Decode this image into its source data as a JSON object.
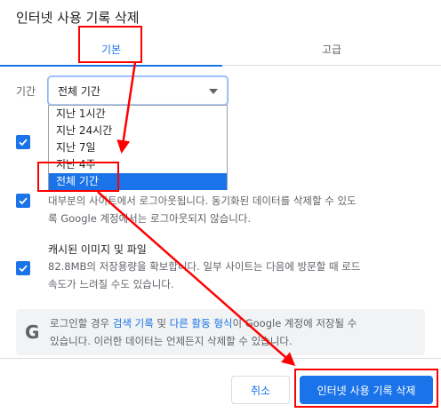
{
  "dialog": {
    "title": "인터넷 사용 기록 삭제"
  },
  "tabs": [
    {
      "label": "기본",
      "active": true
    },
    {
      "label": "고급",
      "active": false
    }
  ],
  "period": {
    "label": "기간",
    "selected": "전체 기간",
    "options": [
      "지난 1시간",
      "지난 24시간",
      "지난 7일",
      "지난 4주",
      "전체 기간"
    ]
  },
  "items": [
    {
      "checked": true,
      "title": "",
      "desc": ""
    },
    {
      "checked": true,
      "title": "",
      "desc_line1": "대부분의 사이트에서 로그아웃됩니다. 동기화된 데이터를 삭제할 수 있도",
      "desc_line2": "록 Google 계정에서는 로그아웃되지 않습니다."
    },
    {
      "checked": true,
      "title": "캐시된 이미지 및 파일",
      "desc_line1": "82.8MB의 저장용량을 확보합니다. 일부 사이트는 다음에 방문할 때 로드",
      "desc_line2": "속도가 느려질 수도 있습니다."
    }
  ],
  "info": {
    "prefix": "로그인할 경우 ",
    "link1": "검색 기록",
    "mid": " 및 ",
    "link2": "다른 활동 형식",
    "suffix": "이 Google 계정에 저장될 수",
    "line2": "있습니다. 이러한 데이터는 언제든지 삭제할 수 있습니다."
  },
  "buttons": {
    "cancel": "취소",
    "delete": "인터넷 사용 기록 삭제"
  },
  "colors": {
    "accent": "#1a73e8",
    "annotation": "#ff0000"
  }
}
